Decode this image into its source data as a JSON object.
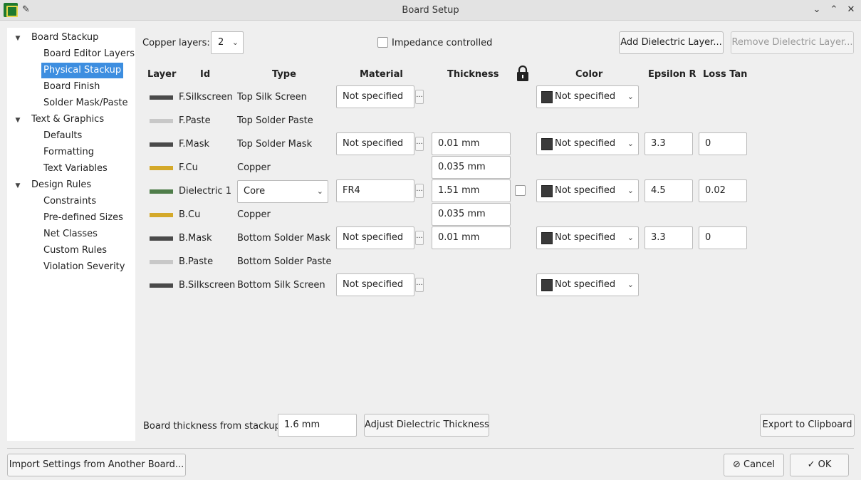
{
  "window": {
    "title": "Board Setup",
    "pin_icon": "pin-icon",
    "controls": [
      "minimize-icon",
      "maximize-icon",
      "close-icon"
    ]
  },
  "sidebar": {
    "groups": [
      {
        "label": "Board Stackup",
        "children": [
          "Board Editor Layers",
          "Physical Stackup",
          "Board Finish",
          "Solder Mask/Paste"
        ]
      },
      {
        "label": "Text & Graphics",
        "children": [
          "Defaults",
          "Formatting",
          "Text Variables"
        ]
      },
      {
        "label": "Design Rules",
        "children": [
          "Constraints",
          "Pre-defined Sizes",
          "Net Classes",
          "Custom Rules",
          "Violation Severity"
        ]
      }
    ],
    "selected": "Physical Stackup"
  },
  "toolbar": {
    "copper_layers_label": "Copper layers:",
    "copper_layers_value": "2",
    "impedance_label": "Impedance controlled",
    "add_dielectric": "Add Dielectric Layer...",
    "remove_dielectric": "Remove Dielectric Layer..."
  },
  "table": {
    "headers": [
      "Layer",
      "Id",
      "Type",
      "Material",
      "Thickness",
      "Color",
      "Epsilon R",
      "Loss Tan"
    ],
    "lock_icon": "lock-icon",
    "rows": [
      {
        "swatch": "#4a4a4a",
        "id": "F.Silkscreen",
        "type": "Top Silk Screen",
        "material": "Not specified",
        "thickness": "",
        "color": "Not specified",
        "epsilon": "",
        "loss": ""
      },
      {
        "swatch": "#c8c8c8",
        "id": "F.Paste",
        "type": "Top Solder Paste",
        "material": "",
        "thickness": "",
        "color": "",
        "epsilon": "",
        "loss": ""
      },
      {
        "swatch": "#4a4a4a",
        "id": "F.Mask",
        "type": "Top Solder Mask",
        "material": "Not specified",
        "thickness": "0.01 mm",
        "color": "Not specified",
        "epsilon": "3.3",
        "loss": "0"
      },
      {
        "swatch": "#d4a92a",
        "id": "F.Cu",
        "type": "Copper",
        "material": "",
        "thickness": "0.035 mm",
        "color": "",
        "epsilon": "",
        "loss": ""
      },
      {
        "swatch": "#4f7d4a",
        "id": "Dielectric 1",
        "type": "Core",
        "material": "FR4",
        "thickness": "1.51 mm",
        "color": "Not specified",
        "epsilon": "4.5",
        "loss": "0.02"
      },
      {
        "swatch": "#d4a92a",
        "id": "B.Cu",
        "type": "Copper",
        "material": "",
        "thickness": "0.035 mm",
        "color": "",
        "epsilon": "",
        "loss": ""
      },
      {
        "swatch": "#4a4a4a",
        "id": "B.Mask",
        "type": "Bottom Solder Mask",
        "material": "Not specified",
        "thickness": "0.01 mm",
        "color": "Not specified",
        "epsilon": "3.3",
        "loss": "0"
      },
      {
        "swatch": "#c8c8c8",
        "id": "B.Paste",
        "type": "Bottom Solder Paste",
        "material": "",
        "thickness": "",
        "color": "",
        "epsilon": "",
        "loss": ""
      },
      {
        "swatch": "#4a4a4a",
        "id": "B.Silkscreen",
        "type": "Bottom Silk Screen",
        "material": "Not specified",
        "thickness": "",
        "color": "Not specified",
        "epsilon": "",
        "loss": ""
      }
    ]
  },
  "footer": {
    "board_thickness_label": "Board thickness from stackup:",
    "board_thickness_value": "1.6 mm",
    "adjust_button": "Adjust Dielectric Thickness",
    "export_button": "Export to Clipboard",
    "import_button": "Import Settings from Another Board...",
    "cancel_button": "Cancel",
    "ok_button": "OK"
  }
}
